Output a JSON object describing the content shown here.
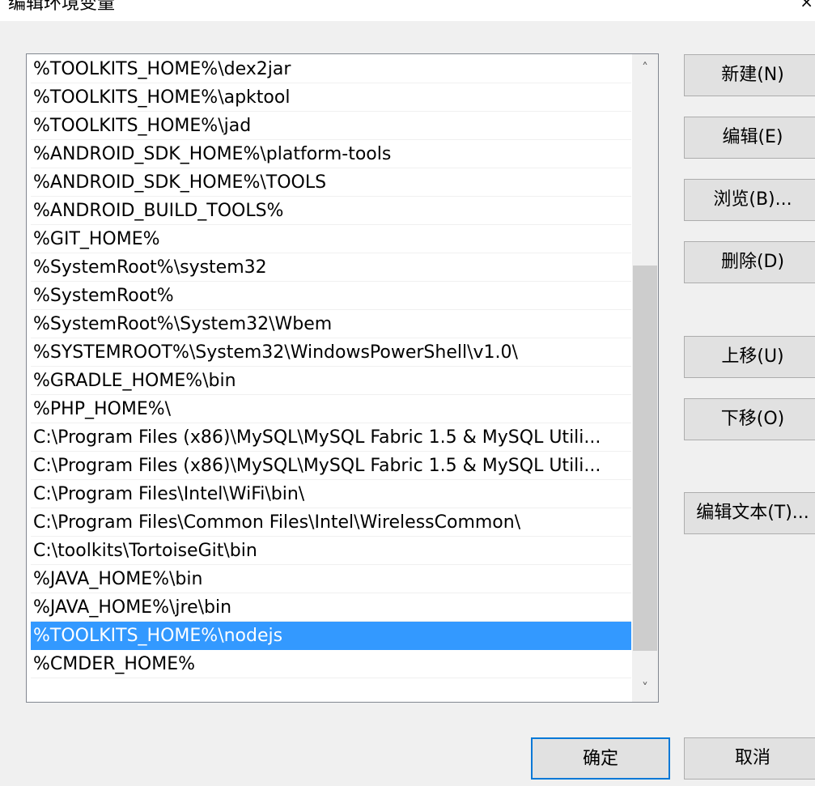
{
  "window": {
    "title": "编辑环境变量",
    "close_glyph": "×"
  },
  "paths": {
    "items": [
      "%TOOLKITS_HOME%\\dex2jar",
      "%TOOLKITS_HOME%\\apktool",
      "%TOOLKITS_HOME%\\jad",
      "%ANDROID_SDK_HOME%\\platform-tools",
      "%ANDROID_SDK_HOME%\\TOOLS",
      "%ANDROID_BUILD_TOOLS%",
      "%GIT_HOME%",
      "%SystemRoot%\\system32",
      "%SystemRoot%",
      "%SystemRoot%\\System32\\Wbem",
      "%SYSTEMROOT%\\System32\\WindowsPowerShell\\v1.0\\",
      "%GRADLE_HOME%\\bin",
      "%PHP_HOME%\\",
      "C:\\Program Files (x86)\\MySQL\\MySQL Fabric 1.5 & MySQL Utili...",
      "C:\\Program Files (x86)\\MySQL\\MySQL Fabric 1.5 & MySQL Utili...",
      "C:\\Program Files\\Intel\\WiFi\\bin\\",
      "C:\\Program Files\\Common Files\\Intel\\WirelessCommon\\",
      "C:\\toolkits\\TortoiseGit\\bin",
      "%JAVA_HOME%\\bin",
      "%JAVA_HOME%\\jre\\bin",
      "%TOOLKITS_HOME%\\nodejs",
      "%CMDER_HOME%"
    ],
    "selected_index": 20
  },
  "scrollbar": {
    "up_glyph": "˄",
    "down_glyph": "˅",
    "thumb_start_fraction": 0.31,
    "thumb_end_fraction": 0.96
  },
  "buttons": {
    "new": "新建(N)",
    "edit": "编辑(E)",
    "browse": "浏览(B)...",
    "delete": "删除(D)",
    "move_up": "上移(U)",
    "move_down": "下移(O)",
    "edit_text": "编辑文本(T)...",
    "ok": "确定",
    "cancel": "取消"
  },
  "colors": {
    "selection": "#3399ff",
    "default_button_border": "#0078d7"
  }
}
